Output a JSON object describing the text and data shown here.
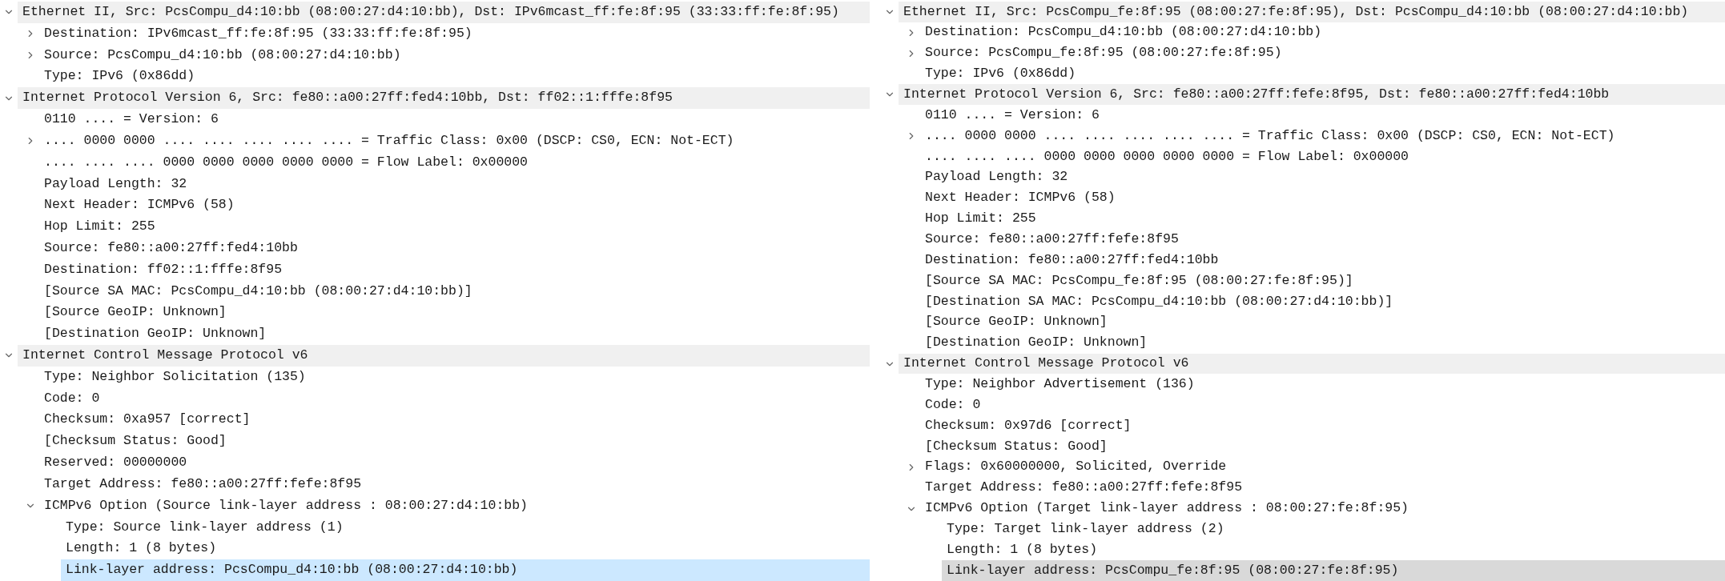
{
  "panes": [
    {
      "focused": true,
      "tree": [
        {
          "label": "Ethernet II, Src: PcsCompu_d4:10:bb (08:00:27:d4:10:bb), Dst: IPv6mcast_ff:fe:8f:95 (33:33:ff:fe:8f:95)",
          "selected": false,
          "expanded": true,
          "children": [
            {
              "label": "Destination: IPv6mcast_ff:fe:8f:95 (33:33:ff:fe:8f:95)",
              "selected": false,
              "expanded": false
            },
            {
              "label": "Source: PcsCompu_d4:10:bb (08:00:27:d4:10:bb)",
              "selected": false,
              "expanded": false
            },
            {
              "label": "Type: IPv6 (0x86dd)",
              "selected": false
            }
          ]
        },
        {
          "label": "Internet Protocol Version 6, Src: fe80::a00:27ff:fed4:10bb, Dst: ff02::1:fffe:8f95",
          "selected": false,
          "expanded": true,
          "children": [
            {
              "label": "0110 .... = Version: 6",
              "selected": false
            },
            {
              "label": ".... 0000 0000 .... .... .... .... .... = Traffic Class: 0x00 (DSCP: CS0, ECN: Not-ECT)",
              "selected": false,
              "expanded": false
            },
            {
              "label": ".... .... .... 0000 0000 0000 0000 0000 = Flow Label: 0x00000",
              "selected": false
            },
            {
              "label": "Payload Length: 32",
              "selected": false
            },
            {
              "label": "Next Header: ICMPv6 (58)",
              "selected": false
            },
            {
              "label": "Hop Limit: 255",
              "selected": false
            },
            {
              "label": "Source: fe80::a00:27ff:fed4:10bb",
              "selected": false
            },
            {
              "label": "Destination: ff02::1:fffe:8f95",
              "selected": false
            },
            {
              "label": "[Source SA MAC: PcsCompu_d4:10:bb (08:00:27:d4:10:bb)]",
              "selected": false
            },
            {
              "label": "[Source GeoIP: Unknown]",
              "selected": false
            },
            {
              "label": "[Destination GeoIP: Unknown]",
              "selected": false
            }
          ]
        },
        {
          "label": "Internet Control Message Protocol v6",
          "selected": false,
          "expanded": true,
          "children": [
            {
              "label": "Type: Neighbor Solicitation (135)",
              "selected": false
            },
            {
              "label": "Code: 0",
              "selected": false
            },
            {
              "label": "Checksum: 0xa957 [correct]",
              "selected": false
            },
            {
              "label": "[Checksum Status: Good]",
              "selected": false
            },
            {
              "label": "Reserved: 00000000",
              "selected": false
            },
            {
              "label": "Target Address: fe80::a00:27ff:fefe:8f95",
              "selected": false
            },
            {
              "label": "ICMPv6 Option (Source link-layer address : 08:00:27:d4:10:bb)",
              "selected": false,
              "expanded": true,
              "children": [
                {
                  "label": "Type: Source link-layer address (1)",
                  "selected": false
                },
                {
                  "label": "Length: 1 (8 bytes)",
                  "selected": false
                },
                {
                  "label": "Link-layer address: PcsCompu_d4:10:bb (08:00:27:d4:10:bb)",
                  "selected": true
                }
              ]
            }
          ]
        }
      ]
    },
    {
      "focused": false,
      "tree": [
        {
          "label": "Ethernet II, Src: PcsCompu_fe:8f:95 (08:00:27:fe:8f:95), Dst: PcsCompu_d4:10:bb (08:00:27:d4:10:bb)",
          "selected": false,
          "expanded": true,
          "children": [
            {
              "label": "Destination: PcsCompu_d4:10:bb (08:00:27:d4:10:bb)",
              "selected": false,
              "expanded": false
            },
            {
              "label": "Source: PcsCompu_fe:8f:95 (08:00:27:fe:8f:95)",
              "selected": false,
              "expanded": false
            },
            {
              "label": "Type: IPv6 (0x86dd)",
              "selected": false
            }
          ]
        },
        {
          "label": "Internet Protocol Version 6, Src: fe80::a00:27ff:fefe:8f95, Dst: fe80::a00:27ff:fed4:10bb",
          "selected": false,
          "expanded": true,
          "children": [
            {
              "label": "0110 .... = Version: 6",
              "selected": false
            },
            {
              "label": ".... 0000 0000 .... .... .... .... .... = Traffic Class: 0x00 (DSCP: CS0, ECN: Not-ECT)",
              "selected": false,
              "expanded": false
            },
            {
              "label": ".... .... .... 0000 0000 0000 0000 0000 = Flow Label: 0x00000",
              "selected": false
            },
            {
              "label": "Payload Length: 32",
              "selected": false
            },
            {
              "label": "Next Header: ICMPv6 (58)",
              "selected": false
            },
            {
              "label": "Hop Limit: 255",
              "selected": false
            },
            {
              "label": "Source: fe80::a00:27ff:fefe:8f95",
              "selected": false
            },
            {
              "label": "Destination: fe80::a00:27ff:fed4:10bb",
              "selected": false
            },
            {
              "label": "[Source SA MAC: PcsCompu_fe:8f:95 (08:00:27:fe:8f:95)]",
              "selected": false
            },
            {
              "label": "[Destination SA MAC: PcsCompu_d4:10:bb (08:00:27:d4:10:bb)]",
              "selected": false
            },
            {
              "label": "[Source GeoIP: Unknown]",
              "selected": false
            },
            {
              "label": "[Destination GeoIP: Unknown]",
              "selected": false
            }
          ]
        },
        {
          "label": "Internet Control Message Protocol v6",
          "selected": false,
          "expanded": true,
          "children": [
            {
              "label": "Type: Neighbor Advertisement (136)",
              "selected": false
            },
            {
              "label": "Code: 0",
              "selected": false
            },
            {
              "label": "Checksum: 0x97d6 [correct]",
              "selected": false
            },
            {
              "label": "[Checksum Status: Good]",
              "selected": false
            },
            {
              "label": "Flags: 0x60000000, Solicited, Override",
              "selected": false,
              "expanded": false
            },
            {
              "label": "Target Address: fe80::a00:27ff:fefe:8f95",
              "selected": false
            },
            {
              "label": "ICMPv6 Option (Target link-layer address : 08:00:27:fe:8f:95)",
              "selected": false,
              "expanded": true,
              "children": [
                {
                  "label": "Type: Target link-layer address (2)",
                  "selected": false
                },
                {
                  "label": "Length: 1 (8 bytes)",
                  "selected": false
                },
                {
                  "label": "Link-layer address: PcsCompu_fe:8f:95 (08:00:27:fe:8f:95)",
                  "selected": true
                }
              ]
            }
          ]
        }
      ]
    }
  ]
}
